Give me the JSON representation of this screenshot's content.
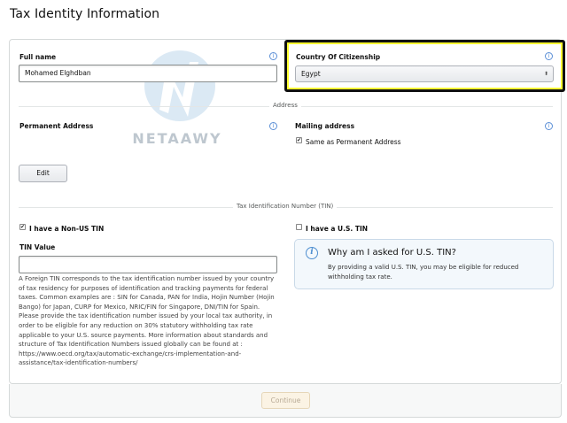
{
  "page": {
    "title": "Tax Identity Information"
  },
  "watermark": {
    "text": "NETAAWY"
  },
  "identity": {
    "full_name_label": "Full name",
    "full_name_value": "Mohamed Elghdban",
    "citizenship_label": "Country Of Citizenship",
    "citizenship_value": "Egypt"
  },
  "address": {
    "section_label": "Address",
    "permanent_label": "Permanent Address",
    "mailing_label": "Mailing address",
    "same_as_label": "Same as Permanent Address",
    "edit_label": "Edit"
  },
  "tin": {
    "section_label": "Tax Identification Number (TIN)",
    "non_us_label": "I have a Non-US TIN",
    "us_label": "I have a U.S. TIN",
    "value_label": "TIN Value",
    "help_text": "A Foreign TIN corresponds to the tax identification number issued by your country of tax residency for purposes of identification and tracking payments for federal taxes. Common examples are : SIN for Canada, PAN for India, Hojin Number (Hojin Bango) for Japan, CURP for Mexico, NRIC/FIN for Singapore, DNI/TIN for Spain. Please provide the tax identification number issued by your local tax authority, in order to be eligible for any reduction on 30% statutory withholding tax rate applicable to your U.S. source payments. More information about standards and structure of Tax Identification Numbers issued globally can be found at : https://www.oecd.org/tax/automatic-exchange/crs-implementation-and-assistance/tax-identification-numbers/",
    "info_title": "Why am I asked for U.S. TIN?",
    "info_body": "By providing a valid U.S. TIN, you may be eligible for reduced withholding tax rate."
  },
  "footer": {
    "continue_label": "Continue"
  },
  "icons": {
    "info": "i",
    "check": "✔",
    "select_arrow": "⬍"
  },
  "colors": {
    "highlight": "#ffff33",
    "info_blue": "#4f8fd0"
  }
}
